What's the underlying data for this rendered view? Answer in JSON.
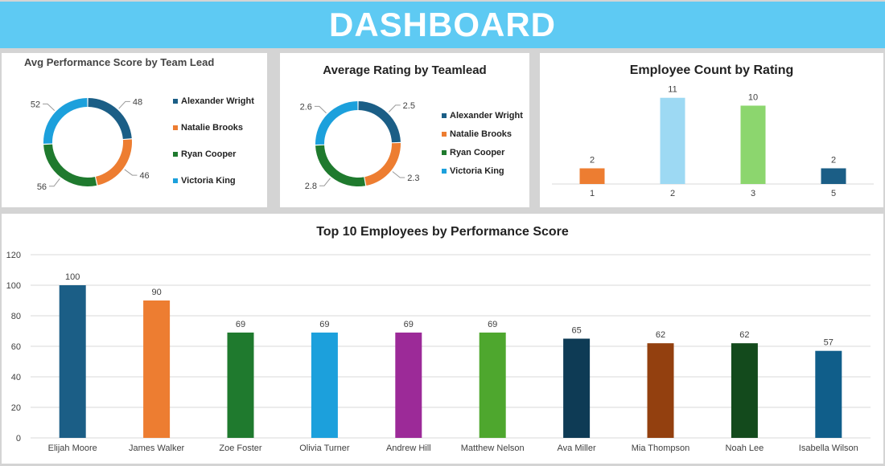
{
  "header": {
    "title": "DASHBOARD"
  },
  "colors": {
    "banner": "#5ecaf3",
    "lead_series": [
      "#1b5e86",
      "#ed7d31",
      "#1f7a2e",
      "#1ca0dc"
    ]
  },
  "chart_data": [
    {
      "type": "pie",
      "title": "Avg Performance Score by Team Lead",
      "categories": [
        "Alexander Wright",
        "Natalie Brooks",
        "Ryan Cooper",
        "Victoria King"
      ],
      "values": [
        48,
        46,
        56,
        52
      ],
      "data_labels": [
        "48",
        "46",
        "56",
        "52"
      ],
      "legend": "right"
    },
    {
      "type": "pie",
      "title": "Average Rating by Teamlead",
      "categories": [
        "Alexander Wright",
        "Natalie Brooks",
        "Ryan Cooper",
        "Victoria King"
      ],
      "values": [
        2.5,
        2.3,
        2.8,
        2.6
      ],
      "data_labels": [
        "2.5",
        "2.3",
        "2.8",
        "2.6"
      ],
      "legend": "right"
    },
    {
      "type": "bar",
      "title": "Employee Count by Rating",
      "categories": [
        "1",
        "2",
        "3",
        "5"
      ],
      "values": [
        2,
        11,
        10,
        2
      ],
      "data_labels": [
        "2",
        "11",
        "10",
        "2"
      ],
      "colors": [
        "#ed7d31",
        "#9dd9f3",
        "#8cd66e",
        "#1b5e86"
      ],
      "grid": false
    },
    {
      "type": "bar",
      "title": "Top 10 Employees by Performance Score",
      "categories": [
        "Elijah Moore",
        "James Walker",
        "Zoe Foster",
        "Olivia Turner",
        "Andrew Hill",
        "Matthew Nelson",
        "Ava Miller",
        "Mia Thompson",
        "Noah Lee",
        "Isabella Wilson"
      ],
      "values": [
        100,
        90,
        69,
        69,
        69,
        69,
        65,
        62,
        62,
        57
      ],
      "data_labels": [
        "100",
        "90",
        "69",
        "69",
        "69",
        "69",
        "65",
        "62",
        "62",
        "57"
      ],
      "colors": [
        "#1b5e86",
        "#ed7d31",
        "#1f7a2e",
        "#1ca0dc",
        "#9c2a98",
        "#4ea72e",
        "#0e3b55",
        "#93400f",
        "#134a1c",
        "#105e8a"
      ],
      "ylim": [
        0,
        120
      ],
      "yticks": [
        "0",
        "20",
        "40",
        "60",
        "80",
        "100",
        "120"
      ],
      "grid": true
    }
  ]
}
